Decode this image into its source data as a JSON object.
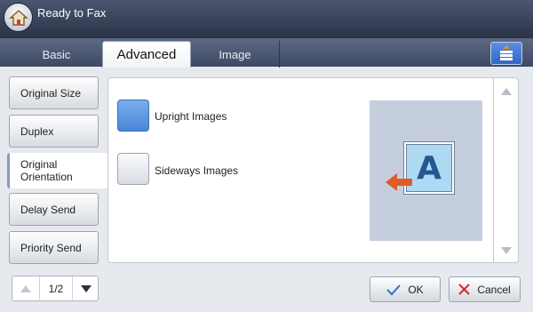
{
  "status": {
    "title": "Ready to Fax"
  },
  "tabs": [
    {
      "label": "Basic"
    },
    {
      "label": "Advanced"
    },
    {
      "label": "Image"
    }
  ],
  "sidebar": {
    "items": [
      {
        "label": "Original Size"
      },
      {
        "label": "Duplex"
      },
      {
        "label": "Original Orientation"
      },
      {
        "label": "Delay Send"
      },
      {
        "label": "Priority Send"
      }
    ]
  },
  "options": {
    "upright": {
      "label": "Upright Images"
    },
    "sideways": {
      "label": "Sideways Images"
    }
  },
  "preview": {
    "letter": "A"
  },
  "pager": {
    "text": "1/2"
  },
  "actions": {
    "ok": "OK",
    "cancel": "Cancel"
  },
  "colors": {
    "accent": "#4b86d8",
    "arrow": "#e05a2a",
    "cancel_x": "#d12a2a",
    "ok_check": "#2f72c9"
  }
}
